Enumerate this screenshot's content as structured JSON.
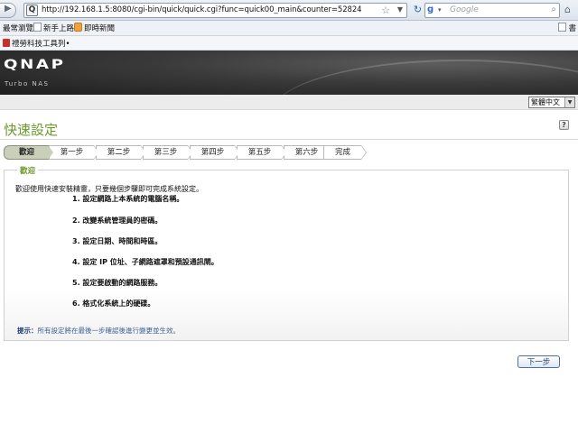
{
  "browser": {
    "url": "http://192.168.1.5:8080/cgi-bin/quick/quick.cgi?func=quick00_main&counter=52824",
    "site_icon_label": "Q",
    "search_placeholder": "Google",
    "search_engine_label": "g",
    "icons": {
      "back": "back-arrow-icon",
      "forward": "forward-arrow-icon",
      "bookmark_star": "star-icon",
      "reload": "reload-icon",
      "search": "search-icon",
      "home": "home-icon"
    }
  },
  "bookmarks": {
    "items": [
      {
        "label": "最常瀏覽"
      },
      {
        "label": "新手上路"
      },
      {
        "label": "即時新聞"
      }
    ],
    "right_label": "書",
    "row2": {
      "label": "禮勞科技工具列•"
    }
  },
  "header": {
    "logo": "QNAP",
    "subtitle": "Turbo NAS"
  },
  "language": {
    "selected": "繁體中文"
  },
  "page": {
    "title": "快速設定",
    "help_label": "?"
  },
  "steps": [
    {
      "label": "歡迎",
      "active": true
    },
    {
      "label": "第一步",
      "active": false
    },
    {
      "label": "第二步",
      "active": false
    },
    {
      "label": "第三步",
      "active": false
    },
    {
      "label": "第四步",
      "active": false
    },
    {
      "label": "第五步",
      "active": false
    },
    {
      "label": "第六步",
      "active": false
    },
    {
      "label": "完成",
      "active": false
    }
  ],
  "panel": {
    "legend": "歡迎",
    "intro": "歡迎使用快速安裝精靈，只要幾個步驟即可完成系統設定。",
    "items": [
      "1. 設定網路上本系統的電腦名稱。",
      "2. 改變系統管理員的密碼。",
      "3. 設定日期、時間和時區。",
      "4. 設定 IP 位址、子網路遮罩和預設通訊閘。",
      "5. 設定要啟動的網路服務。",
      "6. 格式化系統上的硬碟。"
    ],
    "hint_label": "提示：",
    "hint_text": "所有設定將在最後一步確認後進行變更並生效。"
  },
  "actions": {
    "next_label": "下一步"
  },
  "colors": {
    "accent_green": "#6c9a2b",
    "hint_blue": "#3a5f95",
    "active_step": "#c9cfb8"
  }
}
